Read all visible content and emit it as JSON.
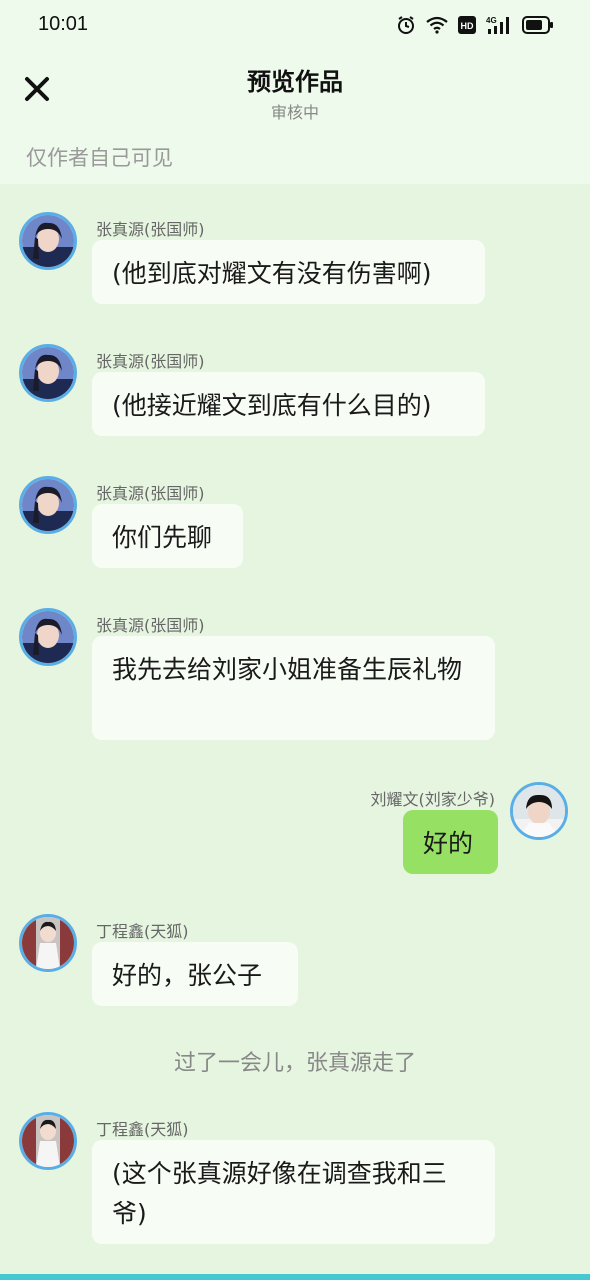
{
  "status_bar": {
    "time": "10:01",
    "icons": [
      "alarm-icon",
      "wifi-icon",
      "hd-icon",
      "signal-4g-icon",
      "battery-icon"
    ]
  },
  "header": {
    "title": "预览作品",
    "subtitle": "审核中",
    "visibility_note": "仅作者自己可见",
    "close_icon": "close-icon"
  },
  "colors": {
    "background": "#e6f5e0",
    "header_background": "#eefaeb",
    "incoming_bubble": "#f7fdf5",
    "outgoing_bubble": "#96e063",
    "avatar_border": "#5aaee6",
    "bottom_accent": "#46c7d2"
  },
  "messages": [
    {
      "sender": "张真源(张国师)",
      "text": "(他到底对耀文有没有伤害啊)",
      "side": "left"
    },
    {
      "sender": "张真源(张国师)",
      "text": "(他接近耀文到底有什么目的)",
      "side": "left"
    },
    {
      "sender": "张真源(张国师)",
      "text": "你们先聊",
      "side": "left"
    },
    {
      "sender": "张真源(张国师)",
      "text": "我先去给刘家小姐准备生辰礼物",
      "side": "left"
    },
    {
      "sender": "刘耀文(刘家少爷)",
      "text": "好的",
      "side": "right"
    },
    {
      "sender": "丁程鑫(天狐)",
      "text": "好的，张公子",
      "side": "left"
    },
    {
      "narration": "过了一会儿，张真源走了"
    },
    {
      "sender": "丁程鑫(天狐)",
      "text": "(这个张真源好像在调查我和三爷)",
      "side": "left"
    }
  ]
}
